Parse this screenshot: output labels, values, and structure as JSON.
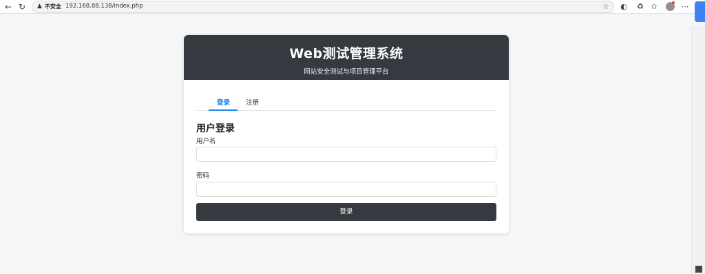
{
  "browser": {
    "security_label": "不安全",
    "url": "192.168.88.138/index.php",
    "back_icon": "back-arrow-icon",
    "refresh_icon": "refresh-icon",
    "star_icon": "star-icon"
  },
  "header": {
    "title": "Web测试管理系统",
    "subtitle": "网站安全测试与项目管理平台"
  },
  "tabs": [
    {
      "label": "登录",
      "active": true
    },
    {
      "label": "注册",
      "active": false
    }
  ],
  "form": {
    "title": "用户登录",
    "username_label": "用户名",
    "username_value": "",
    "password_label": "密码",
    "password_value": "",
    "submit_label": "登录"
  },
  "colors": {
    "header_bg": "#343a40",
    "accent": "#1e88e5",
    "button_bg": "#343a40"
  }
}
